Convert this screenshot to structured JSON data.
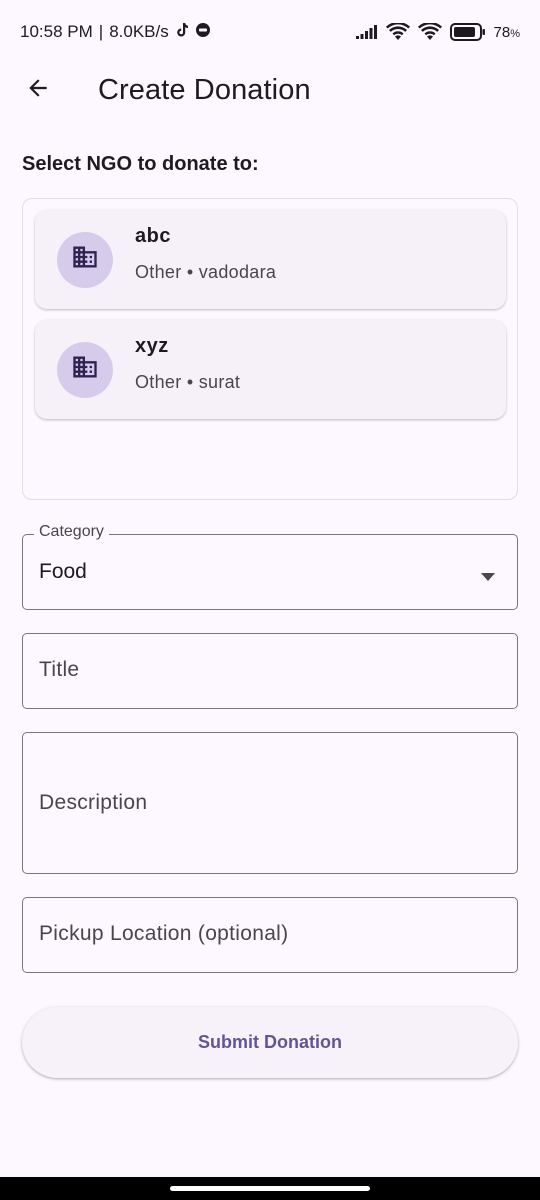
{
  "status_bar": {
    "time": "10:58 PM",
    "separator": "|",
    "speed": "8.0KB/s",
    "battery": "78",
    "battery_unit": "%",
    "icons": [
      "tiktok-icon",
      "app-notification-icon",
      "signal-icon",
      "wifi-icon",
      "wifi-icon",
      "battery-icon"
    ]
  },
  "app_bar": {
    "title": "Create Donation",
    "back_icon": "arrow-left-icon"
  },
  "section": {
    "title": "Select NGO to donate to:"
  },
  "ngos": [
    {
      "name": "abc",
      "subtitle": "Other • vadodara",
      "icon": "building-icon"
    },
    {
      "name": "xyz",
      "subtitle": "Other • surat",
      "icon": "building-icon"
    }
  ],
  "form": {
    "category_label": "Category",
    "category_value": "Food",
    "title_placeholder": "Title",
    "description_placeholder": "Description",
    "pickup_placeholder": "Pickup Location (optional)"
  },
  "submit": {
    "label": "Submit Donation"
  },
  "colors": {
    "background": "#fdf7ff",
    "primary": "#65558f",
    "avatar_bg": "#d7cbec",
    "icon": "#2e2350"
  }
}
